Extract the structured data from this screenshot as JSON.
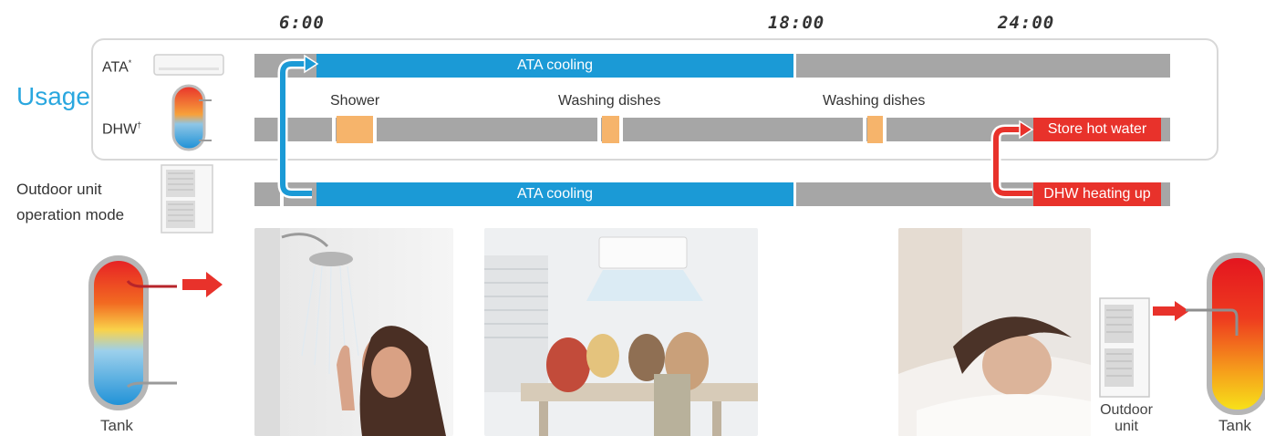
{
  "times": [
    "6:00",
    "18:00",
    "24:00"
  ],
  "usage_label": "Usage",
  "rows": {
    "ata_label": "ATA",
    "ata_sup": "*",
    "dhw_label": "DHW",
    "dhw_sup": "†",
    "outdoor_label_line1": "Outdoor unit",
    "outdoor_label_line2": "operation mode"
  },
  "segments": {
    "ata_cooling_top": "ATA cooling",
    "ata_cooling_bottom": "ATA cooling",
    "store_hot_water": "Store hot water",
    "dhw_heating_up": "DHW heating up"
  },
  "events": {
    "shower": "Shower",
    "washing_dishes_1": "Washing dishes",
    "washing_dishes_2": "Washing dishes"
  },
  "captions": {
    "tank_left": "Tank",
    "outdoor_unit_line1": "Outdoor",
    "outdoor_unit_line2": "unit",
    "tank_right": "Tank"
  },
  "colors": {
    "cooling_blue": "#1b9ad6",
    "heating_red": "#e8322b",
    "event_orange": "#f6b46b",
    "bar_gray": "#a6a6a6",
    "usage_blue": "#2aa7df"
  }
}
